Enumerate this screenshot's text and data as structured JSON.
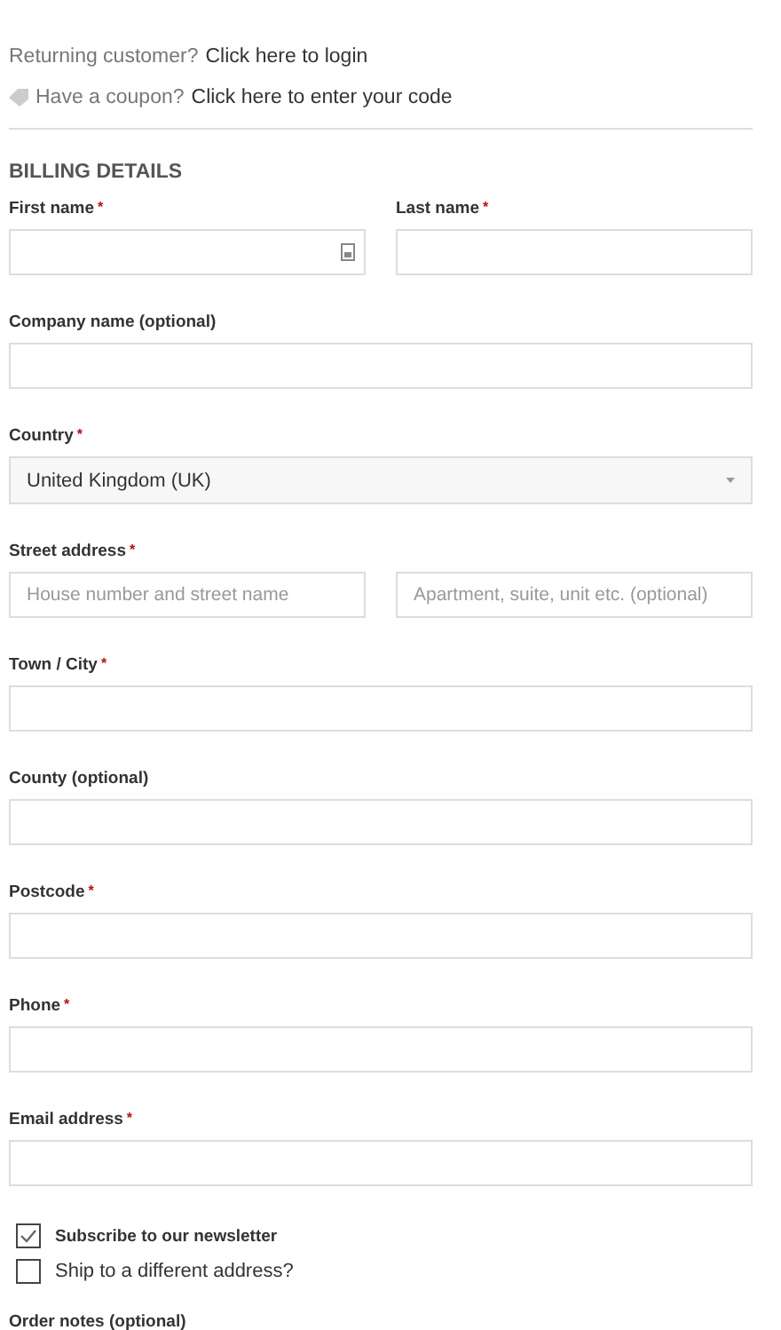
{
  "notices": [
    {
      "kind": "login",
      "prefix": "Returning customer?",
      "link": "Click here to login"
    },
    {
      "kind": "coupon",
      "prefix": "Have a coupon?",
      "link": "Click here to enter your code"
    }
  ],
  "heading": "BILLING DETAILS",
  "rows": [
    {
      "kind": "pair",
      "fields": [
        {
          "label": "First name",
          "asterisk": "*",
          "autofill_icon": true
        },
        {
          "label": "Last name",
          "asterisk": "*"
        }
      ]
    },
    {
      "kind": "single",
      "fields": [
        {
          "label": "Company name (optional)"
        }
      ]
    },
    {
      "kind": "select",
      "fields": [
        {
          "label": "Country",
          "asterisk": "*",
          "value": "United Kingdom (UK)"
        }
      ]
    },
    {
      "kind": "address",
      "label": "Street address",
      "asterisk": "*",
      "fields": [
        {
          "placeholder": "House number and street name"
        },
        {
          "placeholder": "Apartment, suite, unit etc. (optional)"
        }
      ]
    },
    {
      "kind": "single",
      "fields": [
        {
          "label": "Town / City",
          "asterisk": "*"
        }
      ]
    },
    {
      "kind": "single",
      "fields": [
        {
          "label": "County (optional)"
        }
      ]
    },
    {
      "kind": "single",
      "fields": [
        {
          "label": "Postcode",
          "asterisk": "*"
        }
      ]
    },
    {
      "kind": "single",
      "fields": [
        {
          "label": "Phone",
          "asterisk": "*"
        }
      ]
    },
    {
      "kind": "single",
      "fields": [
        {
          "label": "Email address",
          "asterisk": "*"
        }
      ]
    }
  ],
  "checkboxes": [
    {
      "label": "Subscribe to our newsletter",
      "checked": true,
      "bold": true
    },
    {
      "label": "Ship to a different address?",
      "checked": false,
      "bold": false
    }
  ],
  "notes_label": "Order notes (optional)"
}
